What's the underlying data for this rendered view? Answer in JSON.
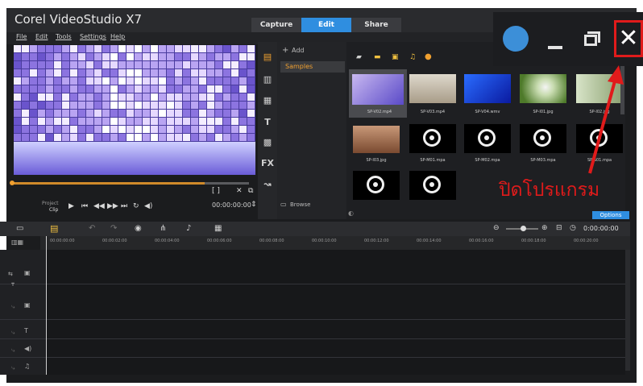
{
  "app": {
    "title": "Corel VideoStudio X7"
  },
  "tabs": [
    {
      "label": "Capture"
    },
    {
      "label": "Edit"
    },
    {
      "label": "Share"
    }
  ],
  "menu": [
    {
      "label": "File"
    },
    {
      "label": "Edit"
    },
    {
      "label": "Tools"
    },
    {
      "label": "Settings"
    },
    {
      "label": "Help"
    }
  ],
  "player": {
    "project_label": "Project",
    "clip_label": "Clip",
    "timecode": "00:00:00:00",
    "bracket_labels": "[ ]"
  },
  "tools": [
    "FX",
    "T"
  ],
  "library": {
    "add_label": "Add",
    "samples_label": "Samples",
    "browse_label": "Browse"
  },
  "thumbnails": [
    {
      "caption": "SP-V02.mp4"
    },
    {
      "caption": "SP-V03.mp4"
    },
    {
      "caption": "SP-V04.wmv"
    },
    {
      "caption": "SP-I01.jpg"
    },
    {
      "caption": "SP-I02.jpg"
    },
    {
      "caption": "SP-I03.jpg"
    },
    {
      "caption": "SP-M01.mpa"
    },
    {
      "caption": "SP-M02.mpa"
    },
    {
      "caption": "SP-M03.mpa"
    },
    {
      "caption": "SP-S01.mpa"
    }
  ],
  "options_label": "Options",
  "timeline": {
    "timecode": "0:00:00:00",
    "ruler": [
      "00:00:00:00",
      "00:00:02:00",
      "00:00:04:00",
      "00:00:06:00",
      "00:00:08:00",
      "00:00:10:00",
      "00:00:12:00",
      "00:00:14:00",
      "00:00:16:00",
      "00:00:18:00",
      "00:00:20:00"
    ]
  },
  "annotation": {
    "text": "ปิดโปรแกรม",
    "color": "#e01b1b"
  },
  "colors": {
    "accent": "#2f8ee0",
    "highlight": "#e01b1b",
    "scrub": "#d08a2a"
  }
}
